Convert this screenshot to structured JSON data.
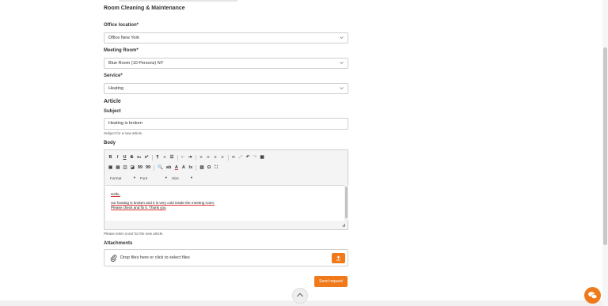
{
  "form": {
    "section_title": "Room Cleaning & Maintenance",
    "office_label": "Office location*",
    "office_value": "Office New York",
    "room_label": "Meeting Room*",
    "room_value": "Blue Room (10 Persons) NY",
    "service_label": "Service*",
    "service_value": "Heating",
    "article_heading": "Article",
    "subject_label": "Subject",
    "subject_value": "Heating is broken",
    "subject_hint": "Subject for a new article.",
    "body_label": "Body",
    "body_hint": "Please enter a text for the new article.",
    "attachments_label": "Attachments",
    "dropzone_text": "Drop files here or click to select files",
    "send_label": "Send request"
  },
  "editor": {
    "toolbar_row1": [
      "B",
      "I",
      "U",
      "S",
      "x₂",
      "x²",
      "¶",
      "≡",
      "☰",
      "⇤",
      "⇥",
      "≡",
      "≡",
      "≡",
      "≡",
      "∞",
      "⤢",
      "↶",
      "↷",
      "▦"
    ],
    "toolbar_row2": [
      "▣",
      "▤",
      "◫",
      "◪",
      "99",
      "99",
      "🔍",
      "ab",
      "A",
      "A",
      "Ix",
      "▥",
      "Ω",
      "⛶"
    ],
    "format_label": "Format",
    "font_label": "Font",
    "size_label": "Size",
    "content_line1": "Hello,",
    "content_line2": "our heating is broken and it is very cold inside the meeting room.",
    "content_line3": "Please check and fix it. Thank you"
  },
  "colors": {
    "accent": "#f07a1a",
    "border": "#cfcfcf"
  },
  "icons": {
    "chevron": "chevron-down-icon",
    "attachment": "paperclip-icon",
    "upload": "upload-icon",
    "scroll_top": "chevron-up-icon",
    "chat": "chat-icon"
  }
}
